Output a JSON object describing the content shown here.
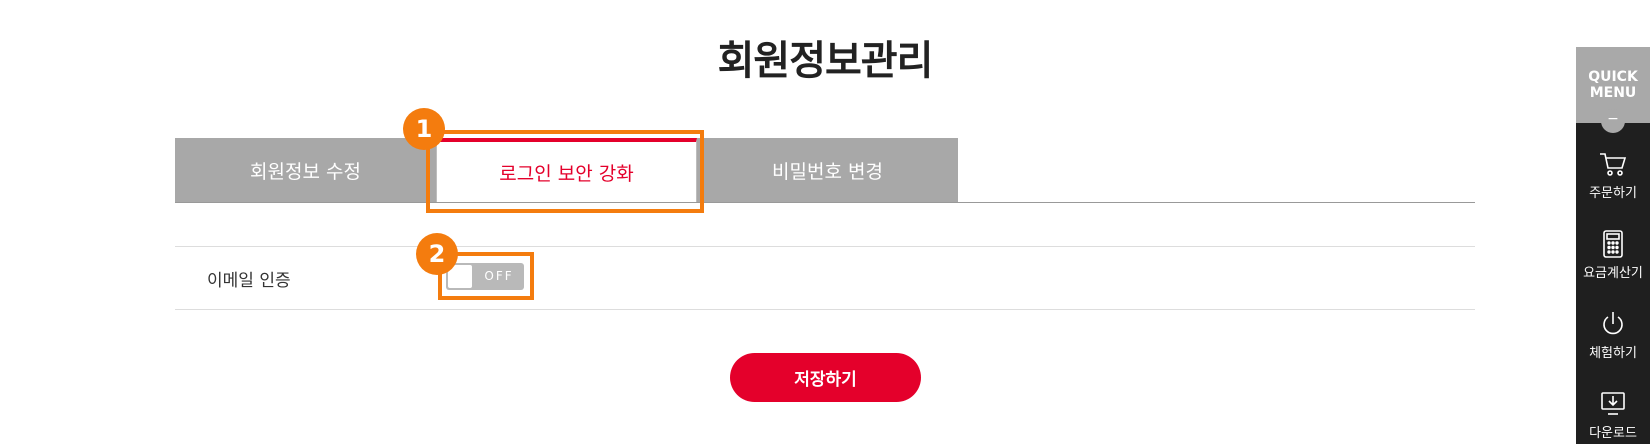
{
  "page": {
    "title": "회원정보관리"
  },
  "tabs": [
    {
      "label": "회원정보 수정",
      "active": false
    },
    {
      "label": "로그인 보안 강화",
      "active": true
    },
    {
      "label": "비밀번호 변경",
      "active": false
    }
  ],
  "settings": {
    "email_auth": {
      "label": "이메일 인증",
      "toggle_text": "OFF",
      "enabled": false
    }
  },
  "actions": {
    "save_label": "저장하기"
  },
  "annotations": {
    "badge_1": "1",
    "badge_2": "2"
  },
  "quick_menu": {
    "title_line1": "QUICK",
    "title_line2": "MENU",
    "collapse_symbol": "−",
    "items": [
      {
        "label": "주문하기",
        "icon": "cart-icon"
      },
      {
        "label": "요금계산기",
        "icon": "calculator-icon"
      },
      {
        "label": "체험하기",
        "icon": "power-icon"
      },
      {
        "label": "다운로드",
        "icon": "download-icon"
      }
    ]
  },
  "colors": {
    "accent": "#e4002b",
    "highlight": "#f47c0e",
    "tab_inactive": "#a8a8a8",
    "quick_menu_bg": "#1f1f1f"
  }
}
